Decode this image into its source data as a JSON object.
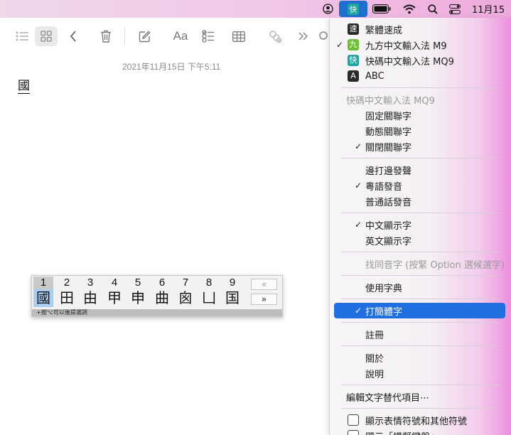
{
  "menubar": {
    "date": "11月15",
    "icons": [
      "user-circle-icon",
      "ime-icon",
      "battery-icon",
      "wifi-icon",
      "search-icon",
      "control-center-icon"
    ]
  },
  "toolbar": {
    "icons": [
      "list-view-icon",
      "grid-view-icon",
      "back-icon",
      "trash-icon",
      "compose-icon",
      "format-text-icon",
      "checklist-icon",
      "table-icon",
      "collaborate-icon",
      "more-icon",
      "search-icon"
    ],
    "format_label": "Aa"
  },
  "note": {
    "date": "2021年11月15日 下午5:11",
    "content": "國"
  },
  "candidate_window": {
    "numbers": [
      "1",
      "2",
      "3",
      "4",
      "5",
      "6",
      "7",
      "8",
      "9"
    ],
    "chars": [
      "國",
      "田",
      "由",
      "甲",
      "申",
      "曲",
      "囪",
      "凵",
      "国"
    ],
    "selected_index": 0,
    "prev_label": "«",
    "next_label": "»",
    "status": "+按⌥可以後提選詞"
  },
  "menu": {
    "input_sources": [
      {
        "label": "繁體速成",
        "icon": "速",
        "checked": false
      },
      {
        "label": "九方中文輸入法 M9",
        "icon": "九",
        "checked": true
      },
      {
        "label": "快碼中文輸入法 MQ9",
        "icon": "快",
        "checked": false
      },
      {
        "label": "ABC",
        "icon": "A",
        "checked": false
      }
    ],
    "section_header": "快碼中文輸入法 MQ9",
    "association": [
      {
        "label": "固定關聯字",
        "checked": false
      },
      {
        "label": "動態關聯字",
        "checked": false
      },
      {
        "label": "關閉關聯字",
        "checked": true
      }
    ],
    "pronunciation": [
      {
        "label": "邊打邊發聲",
        "checked": false
      },
      {
        "label": "粵語發音",
        "checked": true
      },
      {
        "label": "普通話發音",
        "checked": false
      }
    ],
    "display": [
      {
        "label": "中文顯示字",
        "checked": true
      },
      {
        "label": "英文顯示字",
        "checked": false
      }
    ],
    "homophone": "找同音字 (按緊 Option 選候選字)",
    "dictionary": "使用字典",
    "simplified": {
      "label": "打簡體字",
      "checked": true
    },
    "register": "註冊",
    "about": "關於",
    "help": "說明",
    "edit_text_replacements": "編輯文字替代項目⋯",
    "show_emoji": "顯示表情符號和其他符號",
    "show_keyboard": "顯示「模擬鍵盤」"
  },
  "colors": {
    "highlight": "#1f6fe0",
    "menubar_ime_bg": "#1e6fd0",
    "candidate_selected": "#a9cdf3"
  }
}
